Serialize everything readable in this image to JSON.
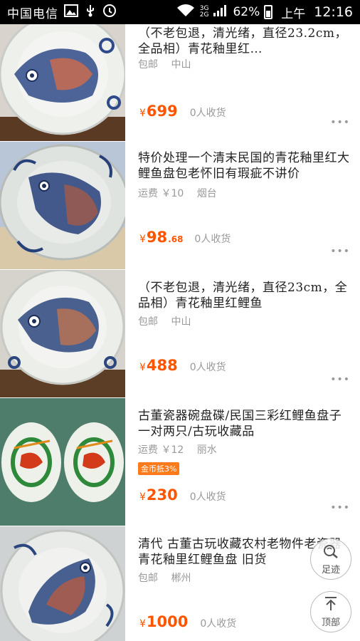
{
  "statusbar": {
    "carrier": "中国电信",
    "network_top": "3G",
    "network_bottom": "2G",
    "battery": "62%",
    "ampm": "上午",
    "time": "12:16",
    "battery_level": 0.62
  },
  "items": [
    {
      "title": "（不老包退，清光绪，直径23.2cm，全品相）青花釉里红…",
      "shipping": "包邮",
      "location": "中山",
      "yen": "¥",
      "price_int": "699",
      "price_cents": "",
      "sold": "0人收货",
      "more": "•••"
    },
    {
      "title": "特价处理一个清末民国的青花釉里红大鲤鱼盘包老怀旧有瑕疵不讲价",
      "shipping": "运费 ￥10",
      "location": "烟台",
      "yen": "¥",
      "price_int": "98",
      "price_cents": ".68",
      "sold": "0人收货",
      "more": "•••"
    },
    {
      "title": "（不老包退，清光绪，直径23cm，全品相）青花釉里红鲤鱼",
      "shipping": "包邮",
      "location": "中山",
      "yen": "¥",
      "price_int": "488",
      "price_cents": "",
      "sold": "0人收货",
      "more": "•••"
    },
    {
      "title": "古董瓷器碗盘碟/民国三彩红鲤鱼盘子一对两只/古玩收藏品",
      "shipping": "运费 ￥12",
      "location": "丽水",
      "badge": "金币抵3%",
      "yen": "¥",
      "price_int": "230",
      "price_cents": "",
      "sold": "0人收货",
      "more": "•••"
    },
    {
      "title": "清代 古董古玩收藏农村老物件老瓷器 青花釉里红鲤鱼盘 旧货",
      "shipping": "包邮",
      "location": "郴州",
      "yen": "¥",
      "price_int": "1000",
      "price_cents": "",
      "sold": "0人收货",
      "more": "•••"
    }
  ],
  "float": {
    "footprint_label": "足迹",
    "top_label": "顶部",
    "footprint_icon": "search-history-icon",
    "top_icon": "arrow-up-icon"
  }
}
